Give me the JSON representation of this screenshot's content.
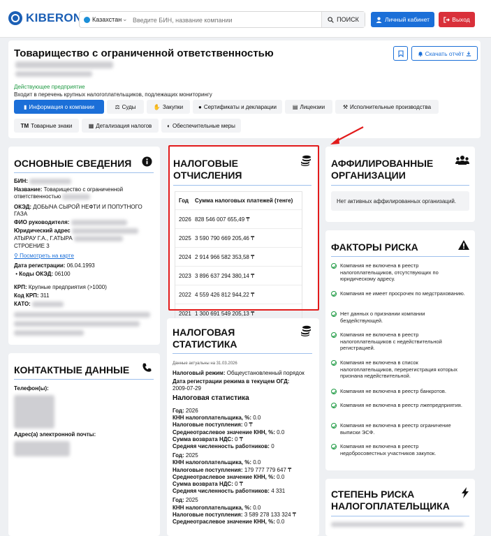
{
  "header": {
    "logo": "KIBERON",
    "country": "Казахстан",
    "search_placeholder": "Введите БИН, название компании",
    "search_button": "ПОИСК",
    "cabinet_button": "Личный кабинет",
    "exit_button": "Выход"
  },
  "company": {
    "title": "Товарищество с ограниченной ответственностью",
    "status": "Действующее предприятие",
    "monitoring": "Входит в перечень крупных налогоплательщиков, подлежащих мониторингу",
    "download_button": "Скачать отчёт",
    "tabs": [
      "Информация о компании",
      "Суды",
      "Закупки",
      "Сертификаты и декларации",
      "Лицензии",
      "Исполнительные производства",
      "Товарные знаки",
      "Детализация налогов",
      "Обеспечительные меры"
    ]
  },
  "basic": {
    "title": "ОСНОВНЫЕ СВЕДЕНИЯ",
    "bin_label": "БИН:",
    "name_label": "Название:",
    "name_value": "Товарищество с ограниченной ответственностью",
    "oked_label": "ОКЭД:",
    "oked_value": "ДОБЫЧА СЫРОЙ НЕФТИ И ПОПУТНОГО ГАЗА",
    "head_label": "ФИО руководителя:",
    "address_label": "Юридический адрес",
    "address_value": "АТЫРАУ Г.А., Г.АТЫРА",
    "address_value2": "СТРОЕНИЕ 3",
    "map_link": "Посмотреть на карте",
    "reg_label": "Дата регистрации:",
    "reg_value": "06.04.1993",
    "oked_codes_label": "Коды ОКЭД:",
    "oked_codes_value": "06100",
    "krp_label": "КРП:",
    "krp_value": "Крупные предприятия (>1000)",
    "krp_code_label": "Код КРП:",
    "krp_code_value": "311",
    "kato_label": "КАТО:"
  },
  "contacts": {
    "title": "КОНТАКТНЫЕ ДАННЫЕ",
    "phones_label": "Телефон(ы):",
    "emails_label": "Адрес(а) электронной почты:"
  },
  "tax": {
    "title_line1": "НАЛОГОВЫЕ",
    "title_line2": "ОТЧИСЛЕНИЯ",
    "col_year": "Год",
    "col_sum": "Сумма налоговых платежей (тенге)",
    "rows": [
      {
        "year": "2026",
        "sum": "828 546 007 655,49 ₸"
      },
      {
        "year": "2025",
        "sum": "3 590 790 669 205,46 ₸"
      },
      {
        "year": "2024",
        "sum": "2 914 966 582 353,58 ₸"
      },
      {
        "year": "2023",
        "sum": "3 896 637 294 380,14 ₸"
      },
      {
        "year": "2022",
        "sum": "4 559 426 812 944,22 ₸"
      },
      {
        "year": "2021",
        "sum": "1 300 691 549 205,13 ₸"
      }
    ]
  },
  "stats": {
    "title_line1": "НАЛОГОВАЯ",
    "title_line2": "СТАТИСТИКА",
    "updated": "Данные актуальны на 31.03.2026",
    "regime_label": "Налоговый режим:",
    "regime_value": "Общеустановленный порядок",
    "regime_date_label": "Дата регистрации режима в текущем ОГД:",
    "regime_date_value": "2009-07-29",
    "subtitle": "Налоговая статистика",
    "l_year": "Год:",
    "l_knn": "КНН налогоплательщика, %:",
    "l_income": "Налоговые поступления:",
    "l_avg": "Среднеотраслевое значение КНН, %:",
    "l_vat": "Сумма возврата НДС:",
    "l_workers": "Средняя численность работников:",
    "b1": {
      "year": "2026",
      "knn": "0.0",
      "income": "0 ₸",
      "avg": "0.0",
      "vat": "0 ₸",
      "workers": "0"
    },
    "b2": {
      "year": "2025",
      "knn": "0.0",
      "income": "179 777 779 647 ₸",
      "avg": "0.0",
      "vat": "0 ₸",
      "workers": "4 331"
    },
    "b3": {
      "year": "2025",
      "knn": "0.0",
      "income": "3 589 278 133 324 ₸",
      "avg": "0.0"
    }
  },
  "affiliated": {
    "title_line1": "АФФИЛИРОВАННЫЕ",
    "title_line2": "ОРГАНИЗАЦИИ",
    "empty_text": "Нет активных аффилированных организаций."
  },
  "risk": {
    "title": "ФАКТОРЫ РИСКА",
    "items": [
      "Компания не включена в реестр налогоплательщиков, отсутствующих по юридическому адресу.",
      "Компания не имеет просрочек по медстрахованию.",
      "Нет данных о признании компании бездействующей.",
      "Компания не включена в реестр налогоплательщиков с недействительной регистрацией.",
      "Компания не включена в список налогоплательщиков, перерегистрация которых признана недействительной.",
      "Компания не включена в реестр банкротов.",
      "Компания не включена в реестр лжепредприятия.",
      "Компания не включена в реестр ограничение выписки ЭСФ.",
      "Компания не включена в реестр недобросовестных участников закупок."
    ]
  },
  "degree": {
    "title_line1": "СТЕПЕНЬ РИСКА",
    "title_line2": "НАЛОГОПЛАТЕЛЬЩИКА"
  },
  "colors": {
    "accent": "#1b6fd8",
    "danger": "#d9303a",
    "success": "#1f9a43",
    "highlight": "#e21b1b"
  }
}
